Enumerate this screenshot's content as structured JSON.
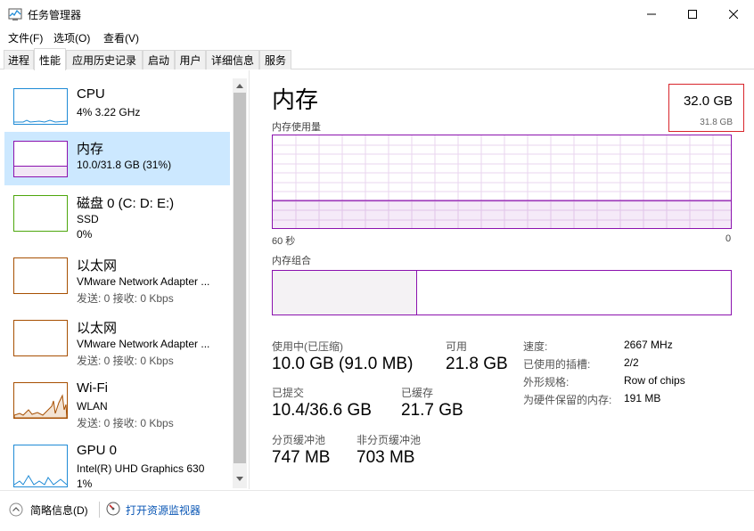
{
  "window": {
    "title": "任务管理器"
  },
  "menu": [
    "文件(F)",
    "选项(O)",
    "查看(V)"
  ],
  "tabs": [
    {
      "label": "进程",
      "active": false
    },
    {
      "label": "性能",
      "active": true
    },
    {
      "label": "应用历史记录",
      "active": false
    },
    {
      "label": "启动",
      "active": false
    },
    {
      "label": "用户",
      "active": false
    },
    {
      "label": "详细信息",
      "active": false
    },
    {
      "label": "服务",
      "active": false
    }
  ],
  "sidebar": [
    {
      "title": "CPU",
      "line1": "4%  3.22 GHz",
      "line2": "",
      "color": "#1f8bd6"
    },
    {
      "title": "内存",
      "line1": "10.0/31.8 GB (31%)",
      "line2": "",
      "color": "#8b12ae",
      "selected": true
    },
    {
      "title": "磁盘 0 (C: D: E:)",
      "line1": "SSD",
      "line2": "0%",
      "color": "#4da60c"
    },
    {
      "title": "以太网",
      "line1": "VMware Network Adapter ...",
      "line2": "发送: 0  接收: 0 Kbps",
      "color": "#a74f01"
    },
    {
      "title": "以太网",
      "line1": "VMware Network Adapter ...",
      "line2": "发送: 0  接收: 0 Kbps",
      "color": "#a74f01"
    },
    {
      "title": "Wi-Fi",
      "line1": "WLAN",
      "line2": "发送: 0  接收: 0 Kbps",
      "color": "#a74f01"
    },
    {
      "title": "GPU 0",
      "line1": "Intel(R) UHD Graphics 630",
      "line2": "1%",
      "color": "#1f8bd6"
    }
  ],
  "main": {
    "title": "内存",
    "total": "32.0 GB",
    "total_sub": "31.8 GB",
    "graph_label": "内存使用量",
    "graph_left": "60 秒",
    "graph_right": "0",
    "composition_label": "内存组合",
    "composition_used_fraction": 0.315,
    "stats": {
      "in_use_label": "使用中(已压缩)",
      "in_use_value": "10.0 GB (91.0 MB)",
      "available_label": "可用",
      "available_value": "21.8 GB",
      "committed_label": "已提交",
      "committed_value": "10.4/36.6 GB",
      "cached_label": "已缓存",
      "cached_value": "21.7 GB",
      "paged_label": "分页缓冲池",
      "paged_value": "747 MB",
      "nonpaged_label": "非分页缓冲池",
      "nonpaged_value": "703 MB"
    },
    "specs": {
      "speed_label": "速度:",
      "speed_value": "2667 MHz",
      "slots_label": "已使用的插槽:",
      "slots_value": "2/2",
      "form_label": "外形规格:",
      "form_value": "Row of chips",
      "reserved_label": "为硬件保留的内存:",
      "reserved_value": "191 MB"
    },
    "memory_usage_fraction": 0.31
  },
  "bottom": {
    "summary": "简略信息(D)",
    "monitor": "打开资源监视器"
  },
  "colors": {
    "memory": "#8b12ae",
    "selected_bg": "#cce8ff",
    "link": "#0b57b5"
  }
}
